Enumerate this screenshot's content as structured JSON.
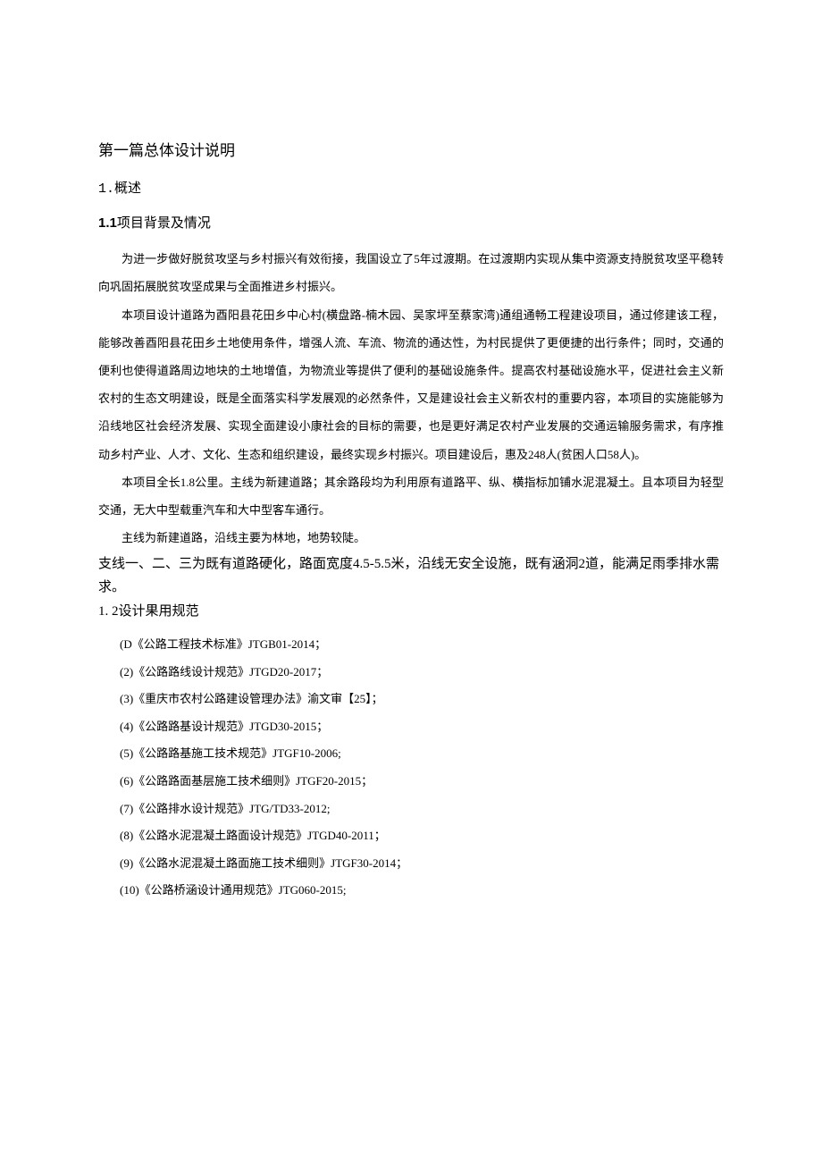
{
  "chapter": {
    "title": "第一篇总体设计说明"
  },
  "section1": {
    "num": "1.概述",
    "sub1": {
      "num": "1.1",
      "title": "项目背景及情况",
      "p1": "为进一步做好脱贫攻坚与乡村振兴有效衔接，我国设立了5年过渡期。在过渡期内实现从集中资源支持脱贫攻坚平稳转向巩固拓展脱贫攻坚成果与全面推进乡村振兴。",
      "p2": "本项目设计道路为酉阳县花田乡中心村(横盘路-楠木园、吴家坪至蔡家湾)通组通畅工程建设项目，通过修建该工程，能够改善酉阳县花田乡土地使用条件，增强人流、车流、物流的通达性，为村民提供了更便捷的出行条件；同时，交通的便利也使得道路周边地块的土地增值，为物流业等提供了便利的基础设施条件。提高农村基础设施水平，促进社会主义新农村的生态文明建设，既是全面落实科学发展观的必然条件，又是建设社会主义新农村的重要内容，本项目的实施能够为沿线地区社会经济发展、实现全面建设小康社会的目标的需要，也是更好满足农村产业发展的交通运输服务需求，有序推动乡村产业、人才、文化、生态和组织建设，最终实现乡村振兴。项目建设后，惠及248人(贫困人口58人)。",
      "p3": "本项目全长1.8公里。主线为新建道路；其余路段均为利用原有道路平、纵、横指标加铺水泥混凝土。且本项目为轻型交通，无大中型载重汽车和大中型客车通行。",
      "p4": "主线为新建道路，沿线主要为林地，地势较陡。",
      "plain1": "支线一、二、三为既有道路硬化，路面宽度4.5-5.5米，沿线无安全设施，既有涵洞2道，能满足雨季排水需求。"
    },
    "sub2": {
      "num": "1. 2",
      "title": "设计果用规范",
      "refs": [
        "(D《公路工程技术标准》JTGB01-2014；",
        "(2)《公路路线设计规范》JTGD20-2017；",
        "(3)《重庆市农村公路建设管理办法》渝文审【25】；",
        "(4)《公路路基设计规范》JTGD30-2015；",
        "(5)《公路路基施工技术规范》JTGF10-2006;",
        "(6)《公路路面基层施工技术细则》JTGF20-2015；",
        "(7)《公路排水设计规范》JTG/TD33-2012;",
        "(8)《公路水泥混凝土路面设计规范》JTGD40-2011；",
        "(9)《公路水泥混凝土路面施工技术细则》JTGF30-2014；",
        "(10)《公路桥涵设计通用规范》JTG060-2015;"
      ]
    }
  }
}
